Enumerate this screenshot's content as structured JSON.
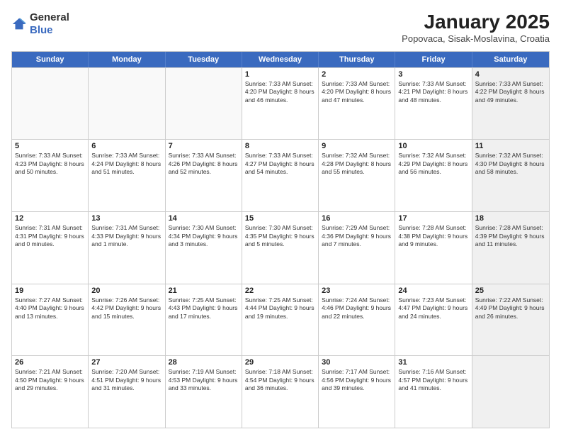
{
  "header": {
    "logo_general": "General",
    "logo_blue": "Blue",
    "title": "January 2025",
    "subtitle": "Popovaca, Sisak-Moslavina, Croatia"
  },
  "calendar": {
    "days_of_week": [
      "Sunday",
      "Monday",
      "Tuesday",
      "Wednesday",
      "Thursday",
      "Friday",
      "Saturday"
    ],
    "weeks": [
      [
        {
          "day": "",
          "detail": "",
          "empty": true
        },
        {
          "day": "",
          "detail": "",
          "empty": true
        },
        {
          "day": "",
          "detail": "",
          "empty": true
        },
        {
          "day": "1",
          "detail": "Sunrise: 7:33 AM\nSunset: 4:20 PM\nDaylight: 8 hours\nand 46 minutes."
        },
        {
          "day": "2",
          "detail": "Sunrise: 7:33 AM\nSunset: 4:20 PM\nDaylight: 8 hours\nand 47 minutes."
        },
        {
          "day": "3",
          "detail": "Sunrise: 7:33 AM\nSunset: 4:21 PM\nDaylight: 8 hours\nand 48 minutes."
        },
        {
          "day": "4",
          "detail": "Sunrise: 7:33 AM\nSunset: 4:22 PM\nDaylight: 8 hours\nand 49 minutes.",
          "shaded": true
        }
      ],
      [
        {
          "day": "5",
          "detail": "Sunrise: 7:33 AM\nSunset: 4:23 PM\nDaylight: 8 hours\nand 50 minutes."
        },
        {
          "day": "6",
          "detail": "Sunrise: 7:33 AM\nSunset: 4:24 PM\nDaylight: 8 hours\nand 51 minutes."
        },
        {
          "day": "7",
          "detail": "Sunrise: 7:33 AM\nSunset: 4:26 PM\nDaylight: 8 hours\nand 52 minutes."
        },
        {
          "day": "8",
          "detail": "Sunrise: 7:33 AM\nSunset: 4:27 PM\nDaylight: 8 hours\nand 54 minutes."
        },
        {
          "day": "9",
          "detail": "Sunrise: 7:32 AM\nSunset: 4:28 PM\nDaylight: 8 hours\nand 55 minutes."
        },
        {
          "day": "10",
          "detail": "Sunrise: 7:32 AM\nSunset: 4:29 PM\nDaylight: 8 hours\nand 56 minutes."
        },
        {
          "day": "11",
          "detail": "Sunrise: 7:32 AM\nSunset: 4:30 PM\nDaylight: 8 hours\nand 58 minutes.",
          "shaded": true
        }
      ],
      [
        {
          "day": "12",
          "detail": "Sunrise: 7:31 AM\nSunset: 4:31 PM\nDaylight: 9 hours\nand 0 minutes."
        },
        {
          "day": "13",
          "detail": "Sunrise: 7:31 AM\nSunset: 4:33 PM\nDaylight: 9 hours\nand 1 minute."
        },
        {
          "day": "14",
          "detail": "Sunrise: 7:30 AM\nSunset: 4:34 PM\nDaylight: 9 hours\nand 3 minutes."
        },
        {
          "day": "15",
          "detail": "Sunrise: 7:30 AM\nSunset: 4:35 PM\nDaylight: 9 hours\nand 5 minutes."
        },
        {
          "day": "16",
          "detail": "Sunrise: 7:29 AM\nSunset: 4:36 PM\nDaylight: 9 hours\nand 7 minutes."
        },
        {
          "day": "17",
          "detail": "Sunrise: 7:28 AM\nSunset: 4:38 PM\nDaylight: 9 hours\nand 9 minutes."
        },
        {
          "day": "18",
          "detail": "Sunrise: 7:28 AM\nSunset: 4:39 PM\nDaylight: 9 hours\nand 11 minutes.",
          "shaded": true
        }
      ],
      [
        {
          "day": "19",
          "detail": "Sunrise: 7:27 AM\nSunset: 4:40 PM\nDaylight: 9 hours\nand 13 minutes."
        },
        {
          "day": "20",
          "detail": "Sunrise: 7:26 AM\nSunset: 4:42 PM\nDaylight: 9 hours\nand 15 minutes."
        },
        {
          "day": "21",
          "detail": "Sunrise: 7:25 AM\nSunset: 4:43 PM\nDaylight: 9 hours\nand 17 minutes."
        },
        {
          "day": "22",
          "detail": "Sunrise: 7:25 AM\nSunset: 4:44 PM\nDaylight: 9 hours\nand 19 minutes."
        },
        {
          "day": "23",
          "detail": "Sunrise: 7:24 AM\nSunset: 4:46 PM\nDaylight: 9 hours\nand 22 minutes."
        },
        {
          "day": "24",
          "detail": "Sunrise: 7:23 AM\nSunset: 4:47 PM\nDaylight: 9 hours\nand 24 minutes."
        },
        {
          "day": "25",
          "detail": "Sunrise: 7:22 AM\nSunset: 4:49 PM\nDaylight: 9 hours\nand 26 minutes.",
          "shaded": true
        }
      ],
      [
        {
          "day": "26",
          "detail": "Sunrise: 7:21 AM\nSunset: 4:50 PM\nDaylight: 9 hours\nand 29 minutes."
        },
        {
          "day": "27",
          "detail": "Sunrise: 7:20 AM\nSunset: 4:51 PM\nDaylight: 9 hours\nand 31 minutes."
        },
        {
          "day": "28",
          "detail": "Sunrise: 7:19 AM\nSunset: 4:53 PM\nDaylight: 9 hours\nand 33 minutes."
        },
        {
          "day": "29",
          "detail": "Sunrise: 7:18 AM\nSunset: 4:54 PM\nDaylight: 9 hours\nand 36 minutes."
        },
        {
          "day": "30",
          "detail": "Sunrise: 7:17 AM\nSunset: 4:56 PM\nDaylight: 9 hours\nand 39 minutes."
        },
        {
          "day": "31",
          "detail": "Sunrise: 7:16 AM\nSunset: 4:57 PM\nDaylight: 9 hours\nand 41 minutes."
        },
        {
          "day": "",
          "detail": "",
          "empty": true,
          "shaded": true
        }
      ]
    ]
  }
}
